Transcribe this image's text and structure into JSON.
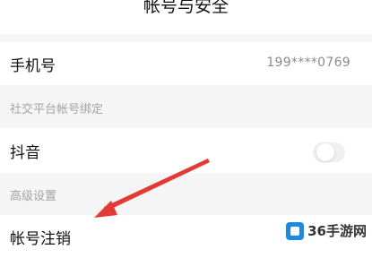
{
  "header": {
    "title": "帐号与安全"
  },
  "phone": {
    "label": "手机号",
    "value": "199****0769"
  },
  "social": {
    "section_title": "社交平台帐号绑定",
    "douyin_label": "抖音",
    "douyin_bound": false
  },
  "advanced": {
    "section_title": "高级设置",
    "cancel_label": "帐号注销"
  },
  "watermark": {
    "text": "36手游网"
  },
  "colors": {
    "arrow": "#e53935",
    "background": "#f5f5f5",
    "muted_text": "#a3a3a3"
  },
  "icons": {
    "annotation": "red-arrow",
    "watermark_logo": "36-logo-icon"
  }
}
